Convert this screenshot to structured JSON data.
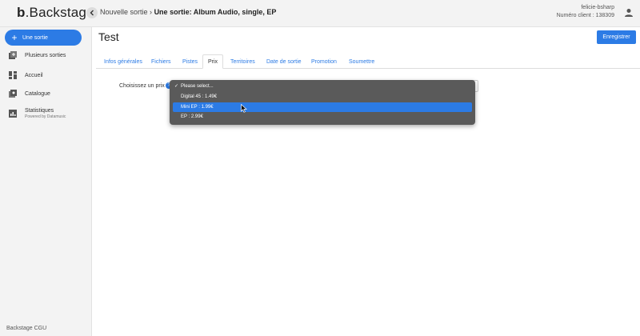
{
  "header": {
    "logo_mark": "b",
    "logo_text": "Backstage",
    "breadcrumb_parent": "Nouvelle sortie",
    "breadcrumb_separator": "›",
    "breadcrumb_current": "Une sortie: Album Audio, single, EP",
    "username": "felicie-bsharp",
    "client_number": "Numéro client : 138309"
  },
  "sidebar": {
    "new_button": "Une sortie",
    "items": [
      {
        "label": "Plusieurs sorties",
        "icon": "add-multiple-icon"
      },
      {
        "label": "Accueil",
        "icon": "dashboard-icon"
      },
      {
        "label": "Catalogue",
        "icon": "catalog-icon"
      },
      {
        "label": "Statistiques",
        "sub": "Powered by Datamusic",
        "icon": "stats-icon"
      }
    ],
    "footer": "Backstage CGU"
  },
  "main": {
    "title": "Test",
    "save_button": "Enregistrer",
    "tabs": [
      {
        "label": "Infos générales",
        "active": false
      },
      {
        "label": "Fichiers",
        "active": false
      },
      {
        "label": "Pistes",
        "active": false
      },
      {
        "label": "Prix",
        "active": true
      },
      {
        "label": "Territoires",
        "active": false
      },
      {
        "label": "Date de sortie",
        "active": false
      },
      {
        "label": "Promotion",
        "active": false
      },
      {
        "label": "Soumettre",
        "active": false
      }
    ],
    "price_label": "Choisissez un prix",
    "help_glyph": "?",
    "dropdown": {
      "options": [
        {
          "label": "Please select...",
          "checked": true,
          "highlighted": false
        },
        {
          "label": "Digital 45 : 1.49€",
          "checked": false,
          "highlighted": false
        },
        {
          "label": "Mini EP : 1.99€",
          "checked": false,
          "highlighted": true
        },
        {
          "label": "EP : 2.99€",
          "checked": false,
          "highlighted": false
        }
      ],
      "check_glyph": "✓"
    }
  },
  "colors": {
    "accent": "#2c7be5",
    "dropdown_bg": "#5a5a5a",
    "chrome_bg": "#f3f3f3"
  }
}
